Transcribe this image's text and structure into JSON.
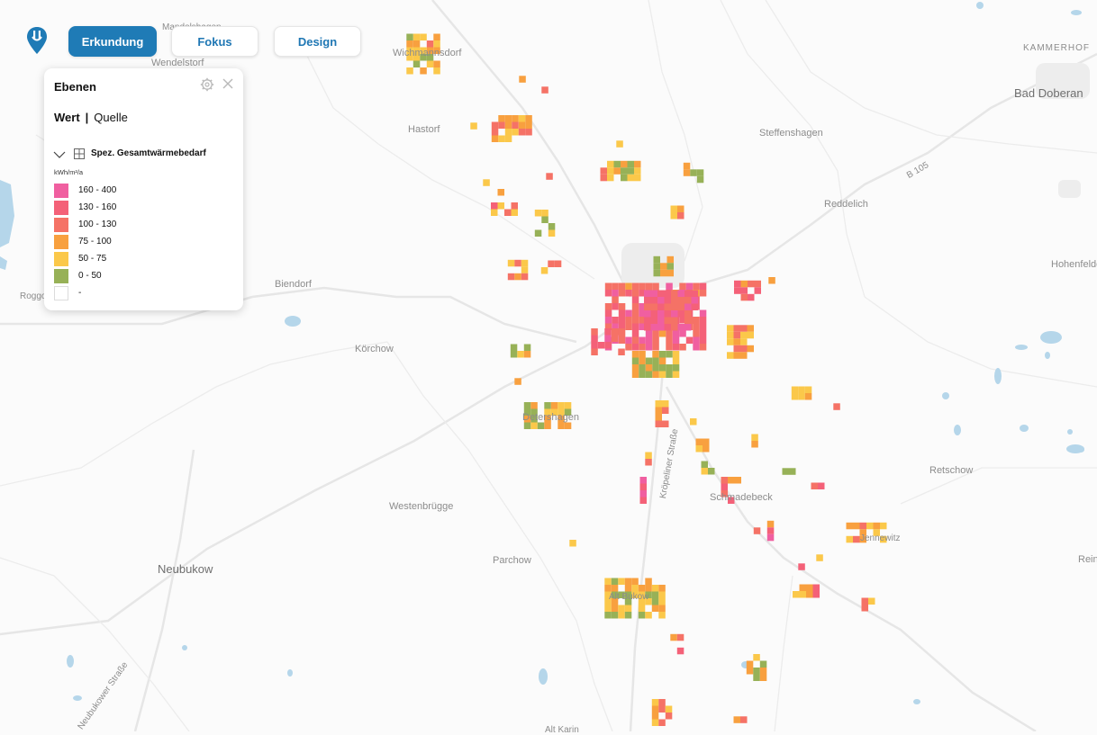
{
  "toolbar": {
    "buttons": [
      {
        "label": "Erkundung",
        "active": true
      },
      {
        "label": "Fokus",
        "active": false
      },
      {
        "label": "Design",
        "active": false
      }
    ],
    "brand_color": "#1f7bb6"
  },
  "panel": {
    "title": "Ebenen",
    "tab_value": "Wert",
    "tab_separator": "|",
    "tab_source": "Quelle",
    "layer_name": "Spez. Gesamtwärmebedarf",
    "unit": "kWh/m²/a",
    "icons": [
      "gear-icon",
      "close-icon",
      "chevron-down-icon",
      "grid-icon"
    ],
    "legend": [
      {
        "label": "160 - 400",
        "color": "#f05fa0"
      },
      {
        "label": "130 - 160",
        "color": "#f46178"
      },
      {
        "label": "100 - 130",
        "color": "#f57266"
      },
      {
        "label": "75 - 100",
        "color": "#f8a03f"
      },
      {
        "label": "50 - 75",
        "color": "#fbc84a"
      },
      {
        "label": "0 - 50",
        "color": "#97b157"
      },
      {
        "label": "-",
        "color": "#ffffff"
      }
    ]
  },
  "map": {
    "labels": {
      "wendelstorf": "Wendelstorf",
      "mandelshagen": "Mandelshagen",
      "wichmannsdorf": "Wichmannsdorf",
      "hastorf": "Hastorf",
      "kammerhof": "KAMMERHOF",
      "bad_doberan": "Bad Doberan",
      "steffenshagen": "Steffenshagen",
      "reddelich": "Reddelich",
      "hohenfelde": "Hohenfelde",
      "roggow": "Roggow",
      "biendorf": "Biendorf",
      "koerchow": "Körchow",
      "detershagen": "Detershagen",
      "retschow": "Retschow",
      "schmadebeck": "Schmadebeck",
      "westenbruegge": "Westenbrügge",
      "neubukow": "Neubukow",
      "parchow": "Parchow",
      "reinshagen": "Reinshagen",
      "alt_karin": "Alt Karin",
      "altes_dorf": "Alt Bukow",
      "jennewitz": "Jennewitz",
      "road_b105": "B 105",
      "road_kroepelin": "Kröpeliner Straße",
      "road_neubukow": "Neubukower Straße"
    },
    "water_color": "#b5d6ea",
    "road_color": "#e5e5e5"
  }
}
